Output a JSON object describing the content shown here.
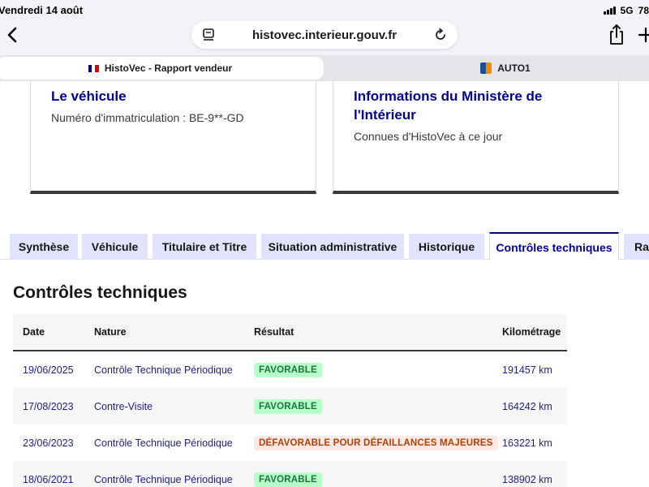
{
  "status_bar": {
    "date": "Vendredi 14 août",
    "network": "5G",
    "battery": "78"
  },
  "browser": {
    "url": "histovec.interieur.gouv.fr",
    "tabs": [
      {
        "label": "HistoVec - Rapport vendeur",
        "active": true
      },
      {
        "label": "AUTO1",
        "active": false
      }
    ]
  },
  "cards": [
    {
      "title": "Le véhicule",
      "description": "Numéro d'immatriculation : BE-9**-GD"
    },
    {
      "title": "Informations du Ministère de l'Intérieur",
      "description": "Connues d'HistoVec à ce jour"
    }
  ],
  "tabs": [
    {
      "label": "Synthèse",
      "active": false
    },
    {
      "label": "Véhicule",
      "active": false
    },
    {
      "label": "Titulaire et Titre",
      "active": false
    },
    {
      "label": "Situation administrative",
      "active": false
    },
    {
      "label": "Historique",
      "active": false
    },
    {
      "label": "Contrôles techniques",
      "active": true
    },
    {
      "label": "Rapport",
      "active": false
    }
  ],
  "section_title": "Contrôles techniques",
  "table": {
    "headers": [
      "Date",
      "Nature",
      "Résultat",
      "Kilométrage"
    ],
    "rows": [
      {
        "date": "19/06/2025",
        "nature": "Contrôle Technique Périodique",
        "result": "FAVORABLE",
        "status": "ok",
        "km": "191457 km"
      },
      {
        "date": "17/08/2023",
        "nature": "Contre-Visite",
        "result": "FAVORABLE",
        "status": "ok",
        "km": "164242 km"
      },
      {
        "date": "23/06/2023",
        "nature": "Contrôle Technique Périodique",
        "result": "DÉFAVORABLE POUR DÉFAILLANCES MAJEURES",
        "status": "ko",
        "km": "163221 km"
      },
      {
        "date": "18/06/2021",
        "nature": "Contrôle Technique Périodique",
        "result": "FAVORABLE",
        "status": "ok",
        "km": "138902 km"
      }
    ]
  },
  "colors": {
    "primary": "#000091",
    "tab_bg": "#e3e3fd",
    "ok_bg": "#b8fec9",
    "ok_text": "#18753c",
    "ko_bg": "#ffe9e6",
    "ko_text": "#b34000"
  }
}
